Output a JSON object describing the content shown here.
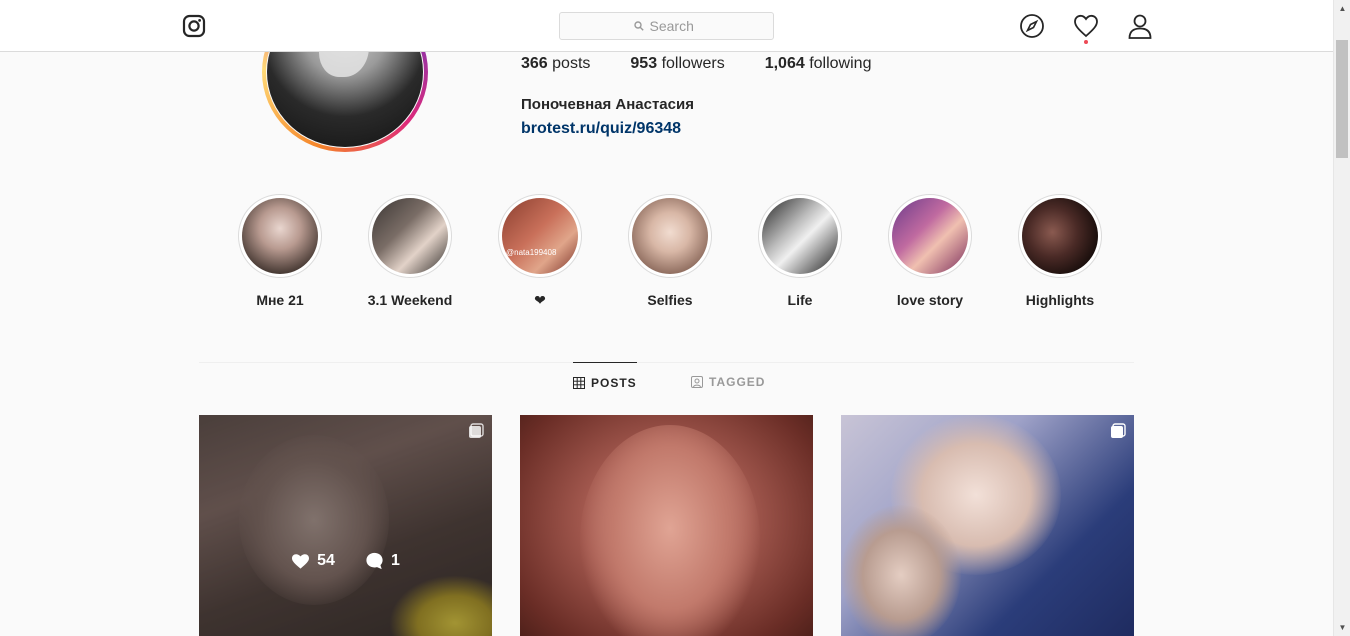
{
  "nav": {
    "search_placeholder": "Search"
  },
  "profile": {
    "posts_count": "366",
    "posts_label": "posts",
    "followers_count": "953",
    "followers_label": "followers",
    "following_count": "1,064",
    "following_label": "following",
    "full_name": "Поночевная Анастасия",
    "link": "brotest.ru/quiz/96348"
  },
  "highlights": [
    {
      "label": "Мне 21"
    },
    {
      "label": "3.1 Weekend"
    },
    {
      "label": "❤",
      "tag": "@nata199408"
    },
    {
      "label": "Selfies"
    },
    {
      "label": "Life"
    },
    {
      "label": "love story"
    },
    {
      "label": "Highlights"
    }
  ],
  "tabs": {
    "posts": "POSTS",
    "tagged": "TAGGED"
  },
  "posts": [
    {
      "likes": "54",
      "comments": "1",
      "multi": true,
      "hovered": true
    },
    {
      "multi": false
    },
    {
      "multi": true
    }
  ],
  "colors": {
    "link": "#003569",
    "border": "#dbdbdb",
    "notification_dot": "#ed4956"
  }
}
